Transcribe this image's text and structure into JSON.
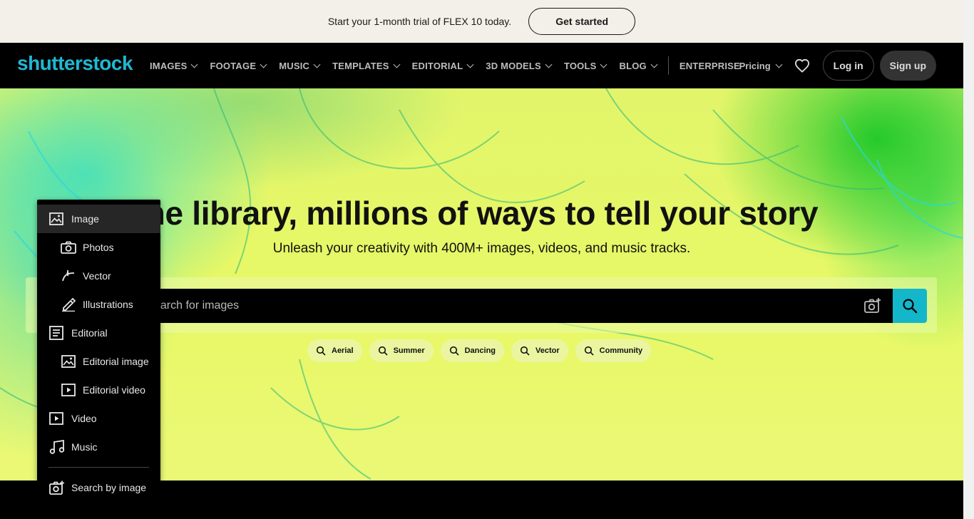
{
  "promo": {
    "text": "Start your 1-month trial of FLEX 10 today.",
    "button": "Get started"
  },
  "nav": {
    "logo": "shutterstock",
    "items": [
      {
        "label": "IMAGES",
        "has_chevron": true
      },
      {
        "label": "FOOTAGE",
        "has_chevron": true
      },
      {
        "label": "MUSIC",
        "has_chevron": true
      },
      {
        "label": "TEMPLATES",
        "has_chevron": true
      },
      {
        "label": "EDITORIAL",
        "has_chevron": true
      },
      {
        "label": "3D MODELS",
        "has_chevron": true
      },
      {
        "label": "TOOLS",
        "has_chevron": true
      },
      {
        "label": "BLOG",
        "has_chevron": true
      }
    ],
    "enterprise": "ENTERPRISE",
    "pricing": "Pricing",
    "heart_icon": "heart-icon",
    "login": "Log in",
    "signup": "Sign up"
  },
  "hero": {
    "title": "ne library, millions of ways to tell your story",
    "subtitle": "Unleash your creativity with 400M+ images, videos, and music tracks."
  },
  "search": {
    "placeholder": "earch for images",
    "camera_icon": "camera-search-icon",
    "search_icon": "search-icon",
    "accent": "#14b6c9"
  },
  "chips": [
    {
      "label": "Aerial"
    },
    {
      "label": "Summer"
    },
    {
      "label": "Dancing"
    },
    {
      "label": "Vector"
    },
    {
      "label": "Community"
    }
  ],
  "dropdown": {
    "items": [
      {
        "label": "Image",
        "icon": "image-icon",
        "selected": true
      },
      {
        "label": "Photos",
        "icon": "camera-icon"
      },
      {
        "label": "Vector",
        "icon": "vector-pen-icon"
      },
      {
        "label": "Illustrations",
        "icon": "brush-icon"
      },
      {
        "label": "Editorial",
        "icon": "article-icon"
      },
      {
        "label": "Editorial image",
        "icon": "image-icon"
      },
      {
        "label": "Editorial video",
        "icon": "video-icon"
      },
      {
        "label": "Video",
        "icon": "video-icon"
      },
      {
        "label": "Music",
        "icon": "music-note-icon"
      }
    ],
    "search_by_image": "Search by image"
  }
}
